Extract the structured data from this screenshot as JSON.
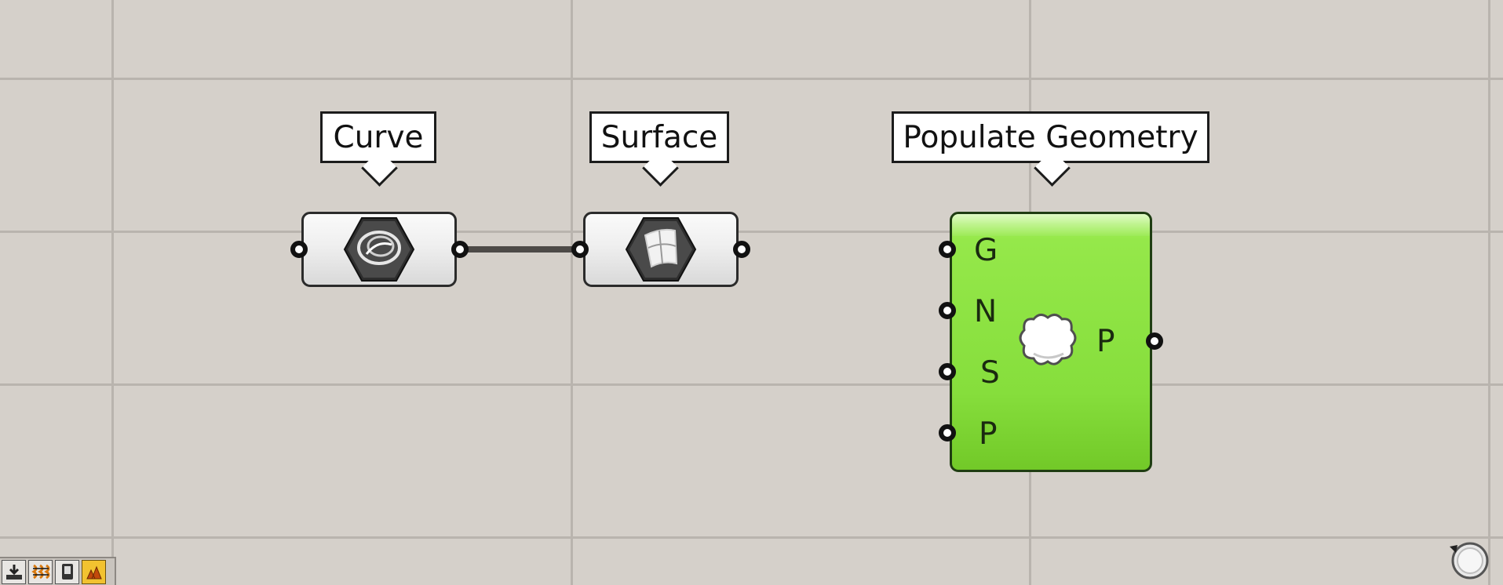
{
  "canvas": {
    "background": "#d5d0ca",
    "grid_color": "#b9b4ae"
  },
  "components": {
    "curve": {
      "label": "Curve",
      "icon": "curve-param-icon"
    },
    "surface": {
      "label": "Surface",
      "icon": "surface-param-icon"
    },
    "populate_geometry": {
      "label": "Populate Geometry",
      "icon": "cloud-icon",
      "inputs": [
        "G",
        "N",
        "S",
        "P"
      ],
      "output": "P",
      "color": "#86de3c"
    }
  },
  "wires": {
    "curve_to_surface": {
      "color": "#4d4a47"
    },
    "surface_to_populate": {
      "color_start": "#b7b1a8",
      "color_end": "#7fd432"
    }
  },
  "toolbar": {
    "buttons": [
      {
        "icon": "download-icon",
        "active": false
      },
      {
        "icon": "wires-icon",
        "active": false
      },
      {
        "icon": "device-icon",
        "active": false
      },
      {
        "icon": "preview-icon",
        "active": true
      }
    ]
  },
  "navigator": {
    "icon": "navigator-icon"
  }
}
